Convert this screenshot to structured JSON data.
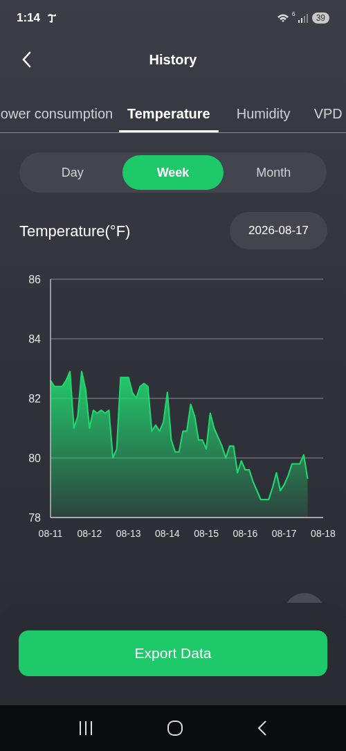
{
  "status_bar": {
    "time": "1:14",
    "wifi_badge": "6",
    "battery": "39"
  },
  "header": {
    "title": "History"
  },
  "tabs": [
    {
      "label": "ower consumption",
      "selected": false
    },
    {
      "label": "Temperature",
      "selected": true
    },
    {
      "label": "Humidity",
      "selected": false
    },
    {
      "label": "VPD",
      "selected": false
    }
  ],
  "periods": [
    {
      "label": "Day",
      "selected": false
    },
    {
      "label": "Week",
      "selected": true
    },
    {
      "label": "Month",
      "selected": false
    }
  ],
  "chart_title": "Temperature(°F)",
  "date": "2026-08-17",
  "chart_data": {
    "type": "area",
    "categories": [
      "08-11",
      null,
      null,
      null,
      null,
      null,
      null,
      null,
      null,
      null,
      "08-12",
      null,
      null,
      null,
      null,
      null,
      null,
      null,
      null,
      null,
      "08-13",
      null,
      null,
      null,
      null,
      null,
      null,
      null,
      null,
      null,
      "08-14",
      null,
      null,
      null,
      null,
      null,
      null,
      null,
      null,
      null,
      "08-15",
      null,
      null,
      null,
      null,
      null,
      null,
      null,
      null,
      null,
      "08-16",
      null,
      null,
      null,
      null,
      null,
      null,
      null,
      null,
      null,
      "08-17",
      null,
      null,
      null,
      null,
      null,
      null,
      null,
      null,
      null,
      "08-18"
    ],
    "series": [
      {
        "color": "#22d46e",
        "values": [
          82.6,
          82.4,
          82.4,
          82.4,
          82.6,
          82.9,
          81.0,
          81.4,
          82.9,
          82.3,
          81.0,
          81.6,
          81.5,
          81.6,
          81.5,
          81.6,
          80.0,
          80.3,
          82.7,
          82.7,
          82.7,
          82.2,
          82.0,
          82.4,
          82.5,
          82.4,
          80.9,
          81.1,
          80.9,
          81.2,
          82.2,
          80.6,
          80.2,
          80.2,
          80.9,
          80.9,
          81.8,
          81.4,
          80.6,
          80.6,
          80.3,
          81.5,
          81.0,
          80.7,
          80.4,
          80.0,
          80.4,
          80.4,
          79.5,
          79.9,
          79.6,
          79.6,
          79.2,
          78.9,
          78.6,
          78.6,
          78.6,
          79.0,
          79.5,
          78.9,
          79.1,
          79.4,
          79.8,
          79.8,
          79.8,
          80.1,
          79.3,
          null,
          null,
          null,
          null
        ]
      }
    ],
    "ylim": [
      78,
      86
    ],
    "grid": true,
    "yticks": [
      78,
      80,
      82,
      84,
      86
    ]
  },
  "export_button": "Export Data"
}
